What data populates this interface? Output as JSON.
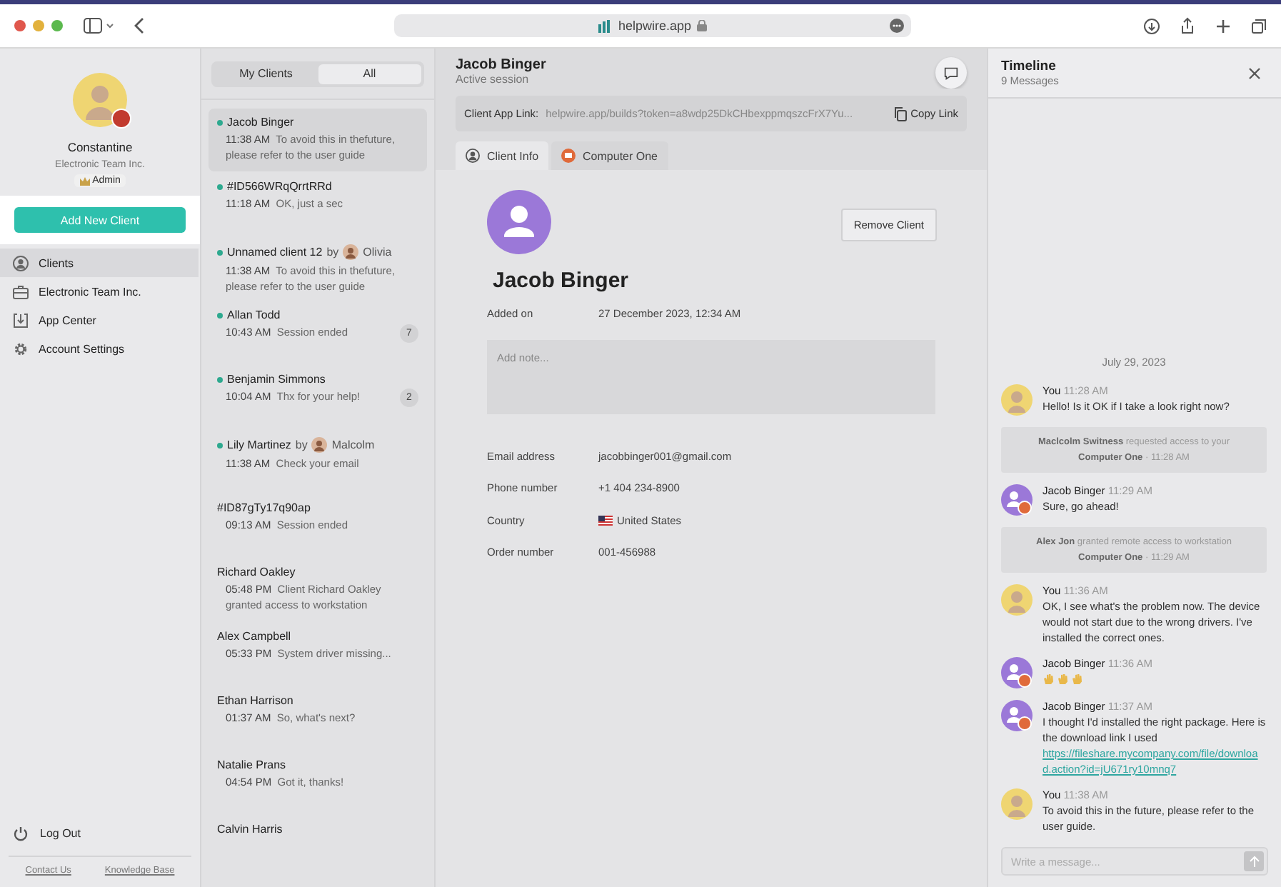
{
  "browser": {
    "address": "helpwire.app"
  },
  "profile": {
    "name": "Constantine",
    "company": "Electronic Team Inc.",
    "role": "Admin"
  },
  "add_button": "Add New Client",
  "nav": [
    {
      "label": "Clients",
      "selected": true
    },
    {
      "label": "Electronic Team Inc.",
      "selected": false
    },
    {
      "label": "App Center",
      "selected": false
    },
    {
      "label": "Account Settings",
      "selected": false
    }
  ],
  "logout": "Log Out",
  "footer_links": [
    "Contact Us",
    "Knowledge Base"
  ],
  "segments": [
    {
      "label": "My Clients",
      "selected": false
    },
    {
      "label": "All",
      "selected": true
    }
  ],
  "clients": [
    {
      "name": "Jacob Binger",
      "online": true,
      "time": "11:38 AM",
      "text": "To avoid this in thefuture, please refer to the user guide",
      "selected": true
    },
    {
      "name": "#ID566WRqQrrtRRd",
      "online": true,
      "time": "11:18 AM",
      "text": "OK, just a sec",
      "selected": false
    },
    {
      "name": "Unnamed client 12",
      "by": "by",
      "agent": "Olivia",
      "online": true,
      "time": "11:38 AM",
      "text": "To avoid this in thefuture, please refer to the user guide",
      "selected": false
    },
    {
      "name": "Allan Todd",
      "online": true,
      "time": "10:43 AM",
      "text": "Session ended",
      "unread": "7",
      "selected": false
    },
    {
      "name": "Benjamin Simmons",
      "online": true,
      "time": "10:04 AM",
      "text": "Thx for your help!",
      "unread": "2",
      "selected": false
    },
    {
      "name": "Lily Martinez",
      "by": "by",
      "agent": "Malcolm",
      "online": true,
      "time": "11:38 AM",
      "text": "Check your email",
      "selected": false
    },
    {
      "name": "#ID87gTy17q90ap",
      "online": false,
      "time": "09:13 AM",
      "text": "Session ended",
      "selected": false
    },
    {
      "name": "Richard Oakley",
      "online": false,
      "time": "05:48 PM",
      "text": "Client Richard Oakley granted access to workstation",
      "selected": false
    },
    {
      "name": "Alex Campbell",
      "online": false,
      "time": "05:33 PM",
      "text": "System driver missing...",
      "selected": false
    },
    {
      "name": "Ethan Harrison",
      "online": false,
      "time": "01:37 AM",
      "text": "So, what's next?",
      "selected": false
    },
    {
      "name": "Natalie Prans",
      "online": false,
      "time": "04:54 PM",
      "text": "Got it, thanks!",
      "selected": false
    },
    {
      "name": "Calvin Harris",
      "online": false,
      "selected": false
    }
  ],
  "detail": {
    "name": "Jacob Binger",
    "status": "Active session",
    "link_label": "Client App Link:",
    "link": "helpwire.app/builds?token=a8wdp25DkCHbexppmqszcFrX7Yu...",
    "copy": "Copy Link",
    "tabs": [
      {
        "label": "Client Info",
        "selected": true
      },
      {
        "label": "Computer One",
        "selected": false
      }
    ],
    "remove": "Remove Client",
    "title": "Jacob Binger",
    "added_label": "Added on",
    "added": "27 December 2023, 12:34 AM",
    "note_placeholder": "Add note...",
    "fields": [
      {
        "label": "Email address",
        "value": "jacobbinger001@gmail.com"
      },
      {
        "label": "Phone number",
        "value": "+1 404 234-8900"
      },
      {
        "label": "Country",
        "value": "United States",
        "flag": true
      },
      {
        "label": "Order number",
        "value": "001-456988"
      }
    ]
  },
  "timeline": {
    "title": "Timeline",
    "count": "9 Messages",
    "date": "July 29, 2023",
    "messages": [
      {
        "kind": "message",
        "from_me": true,
        "author": "You",
        "time": "11:28 AM",
        "text": "Hello! Is it OK if I take a look right now?"
      },
      {
        "kind": "event",
        "actor": "Maclcolm Switness",
        "action": "requested access to your",
        "target": "Computer One",
        "time": "· 11:28 AM"
      },
      {
        "kind": "message",
        "from_me": false,
        "author": "Jacob Binger",
        "time": "11:29 AM",
        "text": "Sure, go ahead!"
      },
      {
        "kind": "event",
        "actor": "Alex Jon",
        "action": "granted remote access to workstation",
        "target": "Computer One",
        "time": "· 11:29 AM"
      },
      {
        "kind": "message",
        "from_me": true,
        "author": "You",
        "time": "11:36 AM",
        "text": "OK, I see what's the problem now. The device would not start due to the wrong drivers. I've installed the correct ones."
      },
      {
        "kind": "reaction",
        "from_me": false,
        "author": "Jacob Binger",
        "time": "11:36 AM"
      },
      {
        "kind": "message",
        "from_me": false,
        "author": "Jacob Binger",
        "time": "11:37 AM",
        "text": "I thought I'd installed the right package. Here is the download link I used",
        "link": "https://fileshare.mycompany.com/file/download.action?id=jU671ry10mnq7"
      },
      {
        "kind": "message",
        "from_me": true,
        "author": "You",
        "time": "11:38 AM",
        "text": "To avoid this in the future, please refer to the user guide."
      }
    ],
    "input_placeholder": "Write a message..."
  }
}
